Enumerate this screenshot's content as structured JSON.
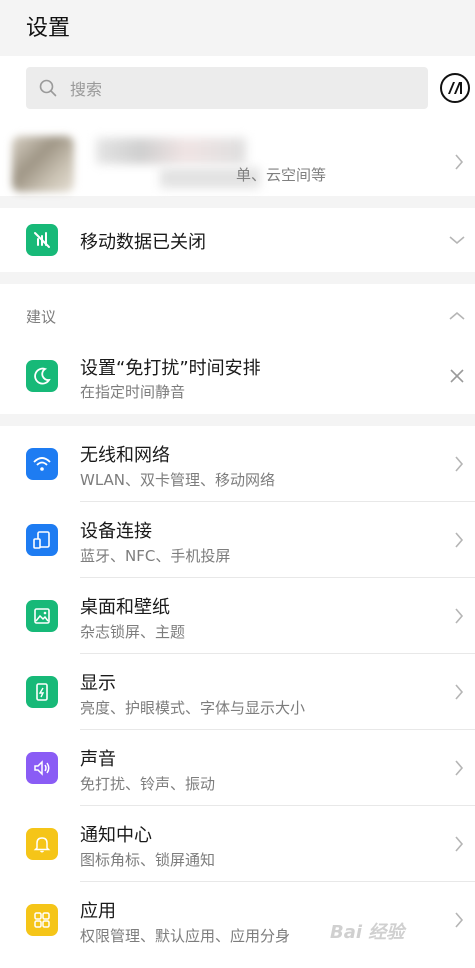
{
  "header": {
    "title": "设置"
  },
  "search": {
    "placeholder": "搜索"
  },
  "account": {
    "subtitle": "单、云空间等"
  },
  "mobile_data": {
    "label": "移动数据已关闭"
  },
  "suggestions": {
    "section_label": "建议",
    "item": {
      "title": "设置“免打扰”时间安排",
      "subtitle": "在指定时间静音"
    }
  },
  "settings": [
    {
      "title": "无线和网络",
      "subtitle": "WLAN、双卡管理、移动网络",
      "icon": "wifi-icon",
      "color": "#1e7cf2"
    },
    {
      "title": "设备连接",
      "subtitle": "蓝牙、NFC、手机投屏",
      "icon": "device-connection-icon",
      "color": "#1e7cf2"
    },
    {
      "title": "桌面和壁纸",
      "subtitle": "杂志锁屏、主题",
      "icon": "wallpaper-icon",
      "color": "#17b978"
    },
    {
      "title": "显示",
      "subtitle": "亮度、护眼模式、字体与显示大小",
      "icon": "display-icon",
      "color": "#17b978"
    },
    {
      "title": "声音",
      "subtitle": "免打扰、铃声、振动",
      "icon": "sound-icon",
      "color": "#8a5cf5"
    },
    {
      "title": "通知中心",
      "subtitle": "图标角标、锁屏通知",
      "icon": "notification-icon",
      "color": "#f5c518"
    },
    {
      "title": "应用",
      "subtitle": "权限管理、默认应用、应用分身",
      "icon": "apps-icon",
      "color": "#f5c518"
    }
  ],
  "colors": {
    "green": "#17b978",
    "blue": "#1e7cf2",
    "purple": "#8a5cf5",
    "yellow": "#f5c518",
    "background": "#f4f4f4"
  },
  "watermark": "Bai 经验"
}
